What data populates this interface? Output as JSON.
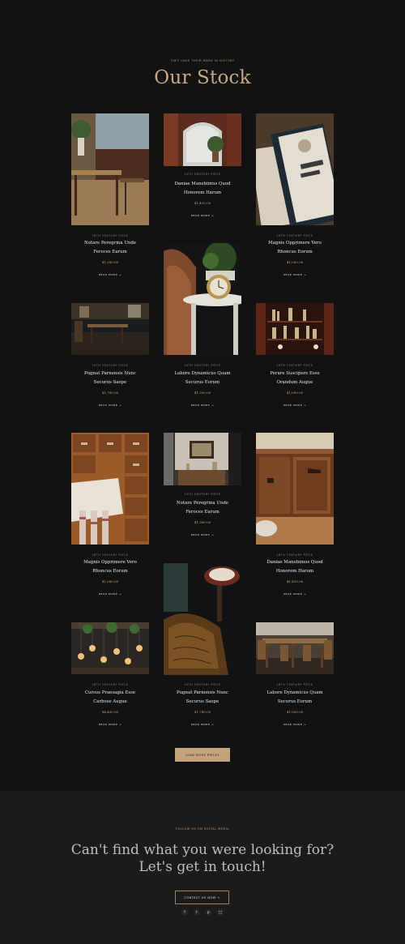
{
  "header": {
    "eyebrow": "THEY HAVE THEIR MARK IN HISTORY",
    "title": "Our Stock"
  },
  "cards": [
    {
      "category": "18TH CENTURY PIECE",
      "name_line1": "Notare Peregrina Unde",
      "name_line2": "Feroces Earum",
      "price": "$1,380.00",
      "more": "READ MORE →",
      "image": "cafe-interior"
    },
    {
      "category": "19TH CENTURY PIECE",
      "name_line1": "Daniae Manebimus Quod",
      "name_line2": "Honorem Harum",
      "price": "$1,410.00",
      "more": "READ MORE →",
      "image": "arched-window-plant"
    },
    {
      "category": "19TH CENTURY PIECE",
      "name_line1": "Magnis Opprimere Vero",
      "name_line2": "Rhoncus Eorum",
      "price": "$1,080.00",
      "more": "READ MORE →",
      "image": "open-book"
    },
    {
      "category": "19TH CENTURY PIECE",
      "name_line1": "Pugnat Parnensis Nunc",
      "name_line2": "Securus Saepe",
      "price": "$1,780.00",
      "more": "READ MORE →",
      "image": "dark-dining-room"
    },
    {
      "category": "19TH CENTURY PIECE",
      "name_line1": "Labore Dynamicus Quam",
      "name_line2": "Securus Eorum",
      "price": "$1,300.00",
      "more": "READ MORE →",
      "image": "clock-and-plant"
    },
    {
      "category": "19TH CENTURY PIECE",
      "name_line1": "Perare Suscipere Esse",
      "name_line2": "Orandum Augue",
      "price": "$1,000.00",
      "more": "READ MORE →",
      "image": "bookshelf"
    },
    {
      "category": "19TH CENTURY PIECE",
      "name_line1": "Notare Peregrina Unde",
      "name_line2": "Feroces Earum",
      "price": "$1,380.00",
      "more": "READ MORE →",
      "image": "framed-room"
    },
    {
      "category": "18TH CENTURY PIECE",
      "name_line1": "Magnis Opprimere Vero",
      "name_line2": "Rhoncus Eorum",
      "price": "$1,080.00",
      "more": "READ MORE →",
      "image": "drawers-and-bag"
    },
    {
      "category": "18TH CENTURY PIECE",
      "name_line1": "Daniae Manebimus Quod",
      "name_line2": "Honorem Harum",
      "price": "$1,410.00",
      "more": "READ MORE →",
      "image": "carved-drawers"
    },
    {
      "category": "19TH CENTURY PIECE",
      "name_line1": "Pugnat Parnensis Nunc",
      "name_line2": "Securus Saepe",
      "price": "$1,780.00",
      "more": "READ MORE →",
      "image": "leather-chair-phone"
    },
    {
      "category": "18TH CENTURY PIECE",
      "name_line1": "Cursus Praesagia Esse",
      "name_line2": "Carbose Augue",
      "price": "$4,490.00",
      "more": "READ MORE →",
      "image": "hanging-bulbs"
    },
    {
      "category": "18TH CENTURY PIECE",
      "name_line1": "Labore Dynamicus Quam",
      "name_line2": "Securus Eorum",
      "price": "$1,300.00",
      "more": "READ MORE →",
      "image": "cafe-tables"
    }
  ],
  "load_more": "LOAD MORE PIECES",
  "footer": {
    "eyebrow": "FOLLOW US ON SOCIAL MEDIA",
    "cta_line1": "Can't find what you were looking for?",
    "cta_line2": "Let's get in touch!",
    "contact_button": "CONTACT US NOW →",
    "socials": [
      {
        "name": "facebook-icon",
        "glyph": "f"
      },
      {
        "name": "twitter-icon",
        "glyph": "t"
      },
      {
        "name": "pinterest-icon",
        "glyph": "p"
      },
      {
        "name": "instagram-icon",
        "glyph": "□"
      }
    ]
  },
  "colors": {
    "background": "#121212",
    "accent": "#c3a27c",
    "footer_bg": "#1b1b1b"
  }
}
